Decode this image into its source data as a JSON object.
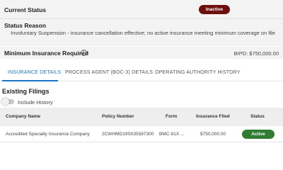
{
  "current_status": {
    "label": "Current Status",
    "badge": "Inactive",
    "badge_color": "#6e0f0f"
  },
  "status_reason": {
    "label": "Status Reason",
    "text": "Involuntary Suspension - insurance cancellation effective; no active insurance meeting minimum coverage on file"
  },
  "minimum_insurance": {
    "label": "Minimum Insurance Required",
    "info_icon": "info-icon",
    "value": "BIPD: $750,000.00"
  },
  "tabs": [
    {
      "label": "INSURANCE DETAILS",
      "active": true
    },
    {
      "label": "PROCESS AGENT (BOC-3) DETAILS",
      "active": false
    },
    {
      "label": "OPERATING AUTHORITY HISTORY",
      "active": false
    }
  ],
  "filings": {
    "title": "Existing Filings",
    "toggle_label": "Include History",
    "include_history": false,
    "columns": [
      "Company Name",
      "Policy Number",
      "Form",
      "Insurance Filed",
      "Status"
    ],
    "rows": [
      {
        "company": "Accredited Specialty Insurance Company",
        "policy": "2CWHMD19S035587300",
        "form": "BMC-91X ...",
        "filed": "$750,000.00",
        "status": "Active"
      }
    ]
  },
  "colors": {
    "accent": "#1a73c7",
    "active_badge": "#2e7d32",
    "inactive_badge": "#6e0f0f"
  }
}
